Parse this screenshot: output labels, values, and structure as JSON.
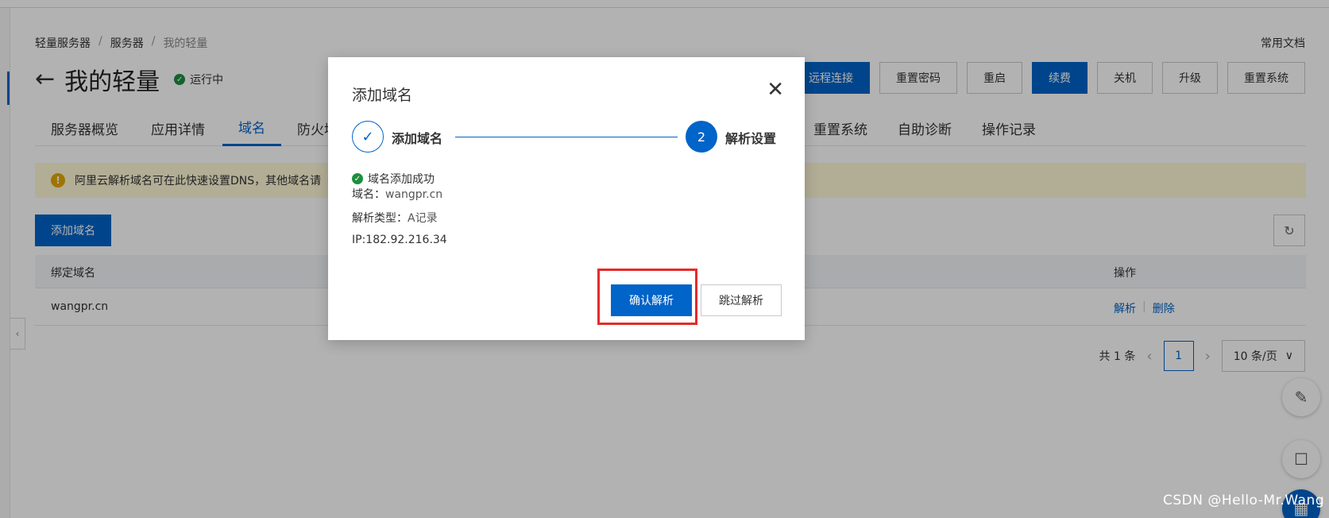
{
  "breadcrumb": {
    "items": [
      "轻量服务器",
      "服务器"
    ],
    "separator": "/",
    "current": "我的轻量"
  },
  "docs_link": "常用文档",
  "header": {
    "back_icon": "←",
    "title": "我的轻量",
    "status": "运行中"
  },
  "actions": [
    {
      "label": "远程连接",
      "primary": true
    },
    {
      "label": "重置密码",
      "primary": false
    },
    {
      "label": "重启",
      "primary": false
    },
    {
      "label": "续费",
      "primary": true
    },
    {
      "label": "关机",
      "primary": false
    },
    {
      "label": "升级",
      "primary": false
    },
    {
      "label": "重置系统",
      "primary": false
    }
  ],
  "tabs": [
    {
      "label": "服务器概览",
      "active": false
    },
    {
      "label": "应用详情",
      "active": false
    },
    {
      "label": "域名",
      "active": true
    },
    {
      "label": "防火墙",
      "active": false
    },
    {
      "label": "重置系统",
      "active": false
    },
    {
      "label": "自助诊断",
      "active": false
    },
    {
      "label": "操作记录",
      "active": false
    }
  ],
  "notice": {
    "icon": "!",
    "text": "阿里云解析域名可在此快速设置DNS，其他域名请"
  },
  "toolbar": {
    "add_domain": "添加域名",
    "refresh_icon": "↻"
  },
  "table": {
    "columns": [
      "绑定域名",
      "操作"
    ],
    "rows": [
      {
        "domain": "wangpr.cn",
        "ops": [
          "解析",
          "删除"
        ]
      }
    ]
  },
  "pagination": {
    "total": "共 1 条",
    "prev": "‹",
    "page": "1",
    "next": "›",
    "page_size": "10 条/页",
    "size_caret": "∨"
  },
  "float_buttons": {
    "edit_icon": "✎",
    "chat_icon": "☐",
    "grid_icon": "▦"
  },
  "left_toggle": "‹",
  "modal": {
    "title": "添加域名",
    "close_icon": "✕",
    "steps": [
      {
        "label": "添加域名",
        "marker": "✓",
        "done": true
      },
      {
        "label": "解析设置",
        "marker": "2",
        "done": false
      }
    ],
    "success": "域名添加成功",
    "success_icon": "✓",
    "domain_label": "域名：",
    "domain_value": "wangpr.cn",
    "type_label": "解析类型：",
    "type_value": "A记录",
    "ip_text": "IP:182.92.216.34",
    "confirm": "确认解析",
    "skip": "跳过解析"
  },
  "watermark": "CSDN @Hello-Mr.Wang",
  "colors": {
    "primary": "#0064c8",
    "success": "#1e8e3e",
    "warning_bg": "#fff8d6",
    "highlight": "#e52a2a"
  }
}
